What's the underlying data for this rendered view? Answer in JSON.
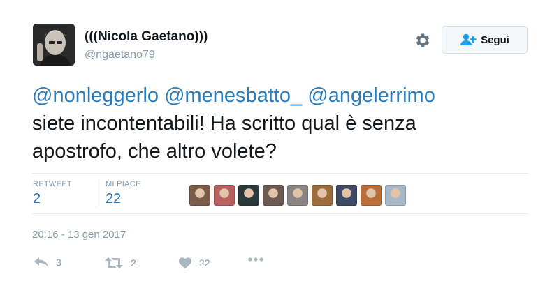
{
  "author": {
    "display_name": "(((Nicola Gaetano)))",
    "handle": "@ngaetano79"
  },
  "follow_button": {
    "label": "Segui"
  },
  "tweet": {
    "mentions": [
      "@nonleggerlo",
      "@menesbatto_",
      "@angelerrimo"
    ],
    "line2": "siete incontentabili! Ha scritto qual è senza",
    "line3": "apostrofo, che altro volete?"
  },
  "stats": {
    "retweet_label": "RETWEET",
    "retweet_count": "2",
    "likes_label": "MI PIACE",
    "likes_count": "22"
  },
  "likers": [
    {
      "color": "#7a5a48"
    },
    {
      "color": "#b85f60"
    },
    {
      "color": "#2a3a3c"
    },
    {
      "color": "#6c5a52"
    },
    {
      "color": "#8a8585"
    },
    {
      "color": "#9b6b3c"
    },
    {
      "color": "#3e4a66"
    },
    {
      "color": "#b86d3a"
    },
    {
      "color": "#a9b8c6"
    }
  ],
  "timestamp": "20:16 - 13 gen 2017",
  "actions": {
    "reply_count": "3",
    "retweet_count": "2",
    "like_count": "22"
  },
  "colors": {
    "link": "#2b7bb9",
    "muted": "#8899a6",
    "border": "#e6ecf0"
  }
}
